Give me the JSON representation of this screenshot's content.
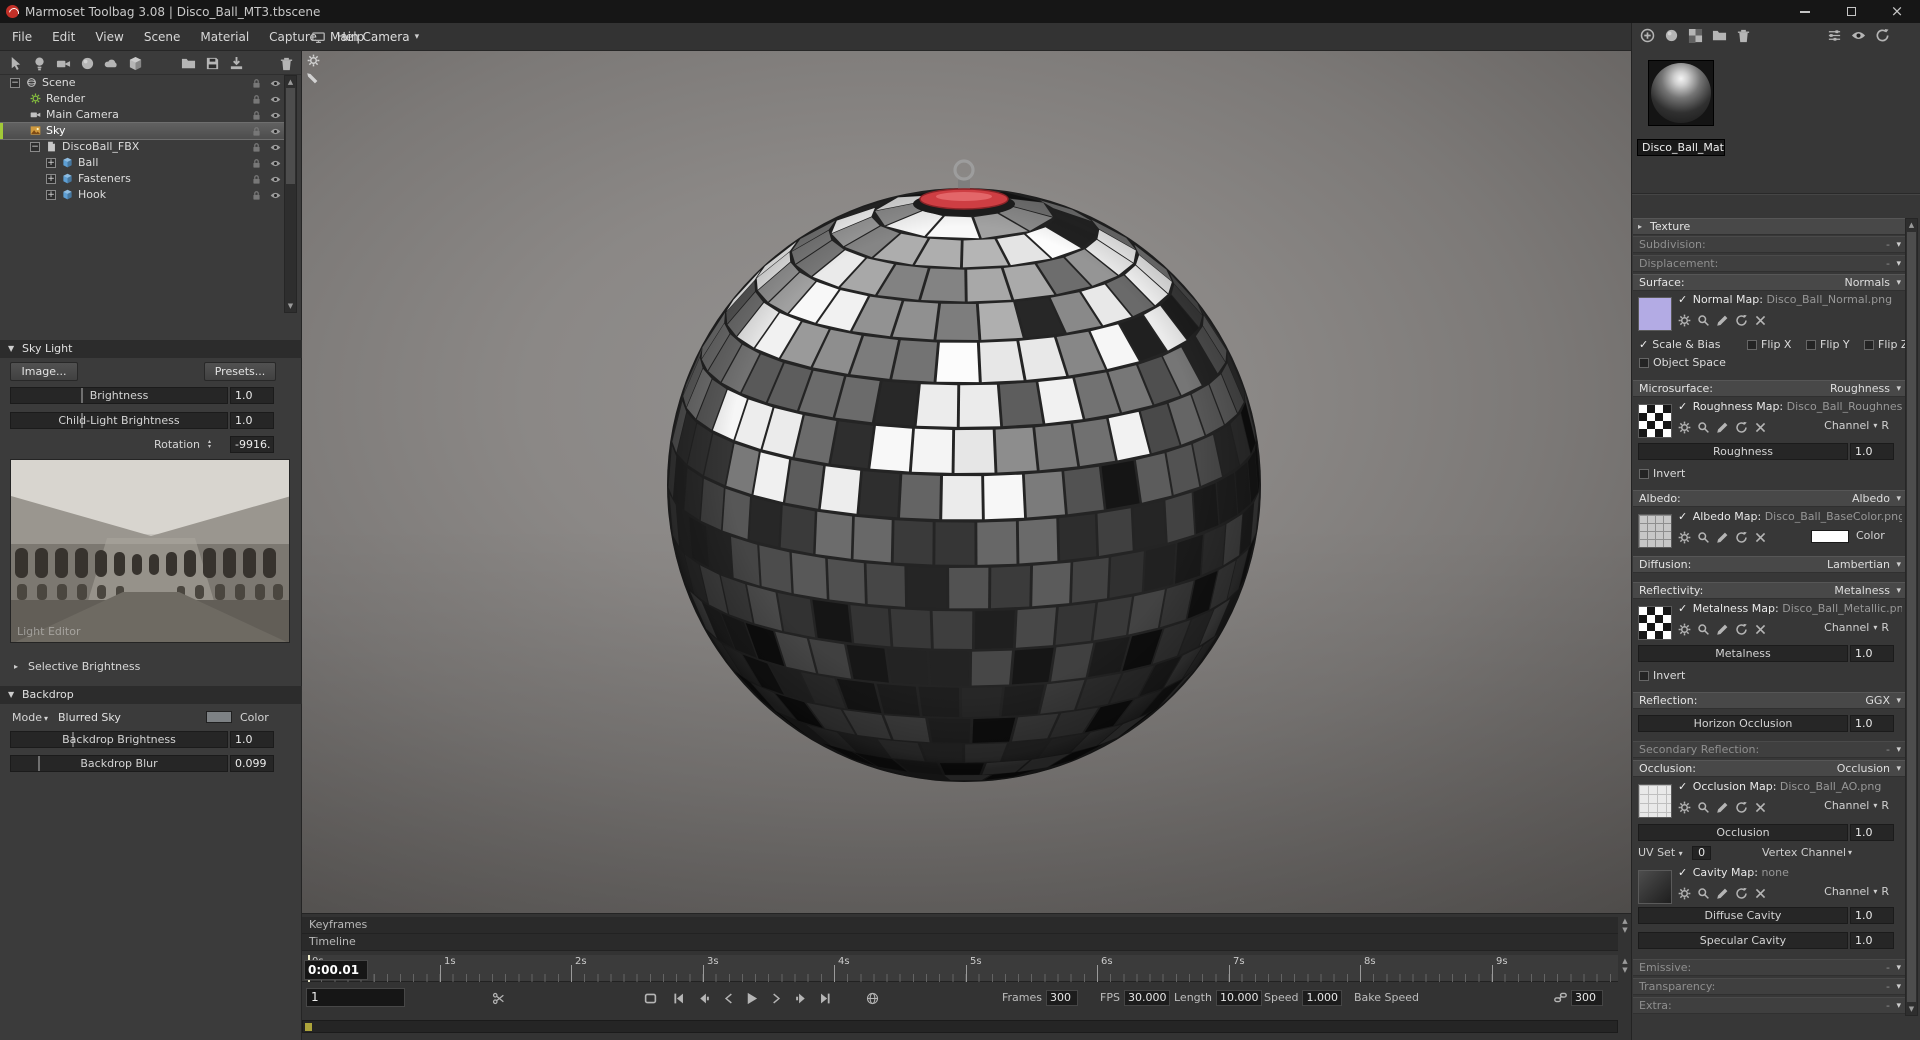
{
  "window": {
    "title": "Marmoset Toolbag 3.08 | Disco_Ball_MT3.tbscene"
  },
  "icons": {
    "chevron_down": "▾",
    "chevron_right": "▸",
    "panel_down": "▼",
    "check": "✓",
    "stepper_up": "▴",
    "stepper_down": "▾",
    "expand_minus": "−",
    "expand_plus": "+",
    "scroll_up": "▲",
    "scroll_down": "▼",
    "close": "×"
  },
  "menu": {
    "items": [
      "File",
      "Edit",
      "View",
      "Scene",
      "Material",
      "Capture",
      "Help"
    ]
  },
  "viewport": {
    "camera_label": "Main Camera"
  },
  "scene": {
    "tree": [
      {
        "label": "Scene"
      },
      {
        "label": "Render"
      },
      {
        "label": "Main Camera"
      },
      {
        "label": "Sky"
      },
      {
        "label": "DiscoBall_FBX"
      },
      {
        "label": "Ball"
      },
      {
        "label": "Fasteners"
      },
      {
        "label": "Hook"
      }
    ]
  },
  "sky_light": {
    "title": "Sky Light",
    "image_button": "Image...",
    "presets_button": "Presets...",
    "brightness_label": "Brightness",
    "brightness_value": "1.0",
    "child_label": "Child-Light Brightness",
    "child_value": "1.0",
    "rotation_label": "Rotation",
    "rotation_value": "-9916.",
    "preview_caption": "Light Editor",
    "selective_label": "Selective Brightness"
  },
  "backdrop": {
    "title": "Backdrop",
    "mode_label": "Mode",
    "mode_value": "Blurred Sky",
    "color_label": "Color",
    "brightness_label": "Backdrop Brightness",
    "brightness_value": "1.0",
    "blur_label": "Backdrop Blur",
    "blur_value": "0.099"
  },
  "timeline": {
    "keyframes_label": "Keyframes",
    "timeline_label": "Timeline",
    "ticks": [
      "0s",
      "1s",
      "2s",
      "3s",
      "4s",
      "5s",
      "6s",
      "7s",
      "8s",
      "9s"
    ],
    "time": "0:00.01",
    "frame": "1",
    "frames_label": "Frames",
    "frames_value": "300",
    "fps_label": "FPS",
    "fps_value": "30.000",
    "length_label": "Length",
    "length_value": "10.000",
    "speed_label": "Speed",
    "speed_value": "1.000",
    "bake_label": "Bake Speed",
    "bake_value": "300"
  },
  "material": {
    "name": "Disco_Ball_Mat",
    "sections": {
      "texture": {
        "title": "Texture"
      },
      "subdivision": {
        "title": "Subdivision:",
        "mode": "-"
      },
      "displacement": {
        "title": "Displacement:",
        "mode": "-"
      },
      "surface": {
        "title": "Surface:",
        "mode": "Normals",
        "map_label": "Normal Map:",
        "map_file": "Disco_Ball_Normal.png",
        "checks": [
          "Scale & Bias",
          "Flip X",
          "Flip Y",
          "Flip Z"
        ],
        "object_space": "Object Space"
      },
      "microsurface": {
        "title": "Microsurface:",
        "mode": "Roughness",
        "map_label": "Roughness Map:",
        "map_file": "Disco_Ball_Roughness.png",
        "channel_label": "Channel",
        "channel_value": "R",
        "slider_label": "Roughness",
        "slider_value": "1.0",
        "invert_label": "Invert"
      },
      "albedo": {
        "title": "Albedo:",
        "mode": "Albedo",
        "map_label": "Albedo Map:",
        "map_file": "Disco_Ball_BaseColor.png",
        "color_label": "Color"
      },
      "diffusion": {
        "title": "Diffusion:",
        "mode": "Lambertian"
      },
      "reflectivity": {
        "title": "Reflectivity:",
        "mode": "Metalness",
        "map_label": "Metalness Map:",
        "map_file": "Disco_Ball_Metallic.png",
        "channel_label": "Channel",
        "channel_value": "R",
        "slider_label": "Metalness",
        "slider_value": "1.0",
        "invert_label": "Invert"
      },
      "reflection": {
        "title": "Reflection:",
        "mode": "GGX",
        "slider_label": "Horizon Occlusion",
        "slider_value": "1.0"
      },
      "secondary": {
        "title": "Secondary Reflection:",
        "mode": "-"
      },
      "occlusion": {
        "title": "Occlusion:",
        "mode": "Occlusion",
        "map_label": "Occlusion Map:",
        "map_file": "Disco_Ball_AO.png",
        "channel_label": "Channel",
        "channel_value": "R",
        "slider_label": "Occlusion",
        "slider_value": "1.0",
        "uv_label": "UV Set",
        "uv_value": "0",
        "vertex_label": "Vertex Channel",
        "cavity_label": "Cavity Map:",
        "cavity_file": "none",
        "cavity_channel_label": "Channel",
        "cavity_channel_value": "R",
        "diffuse_label": "Diffuse Cavity",
        "diffuse_value": "1.0",
        "specular_label": "Specular Cavity",
        "specular_value": "1.0"
      },
      "emissive": {
        "title": "Emissive:",
        "mode": "-"
      },
      "transparency": {
        "title": "Transparency:",
        "mode": "-"
      },
      "extra": {
        "title": "Extra:",
        "mode": "-"
      }
    }
  }
}
